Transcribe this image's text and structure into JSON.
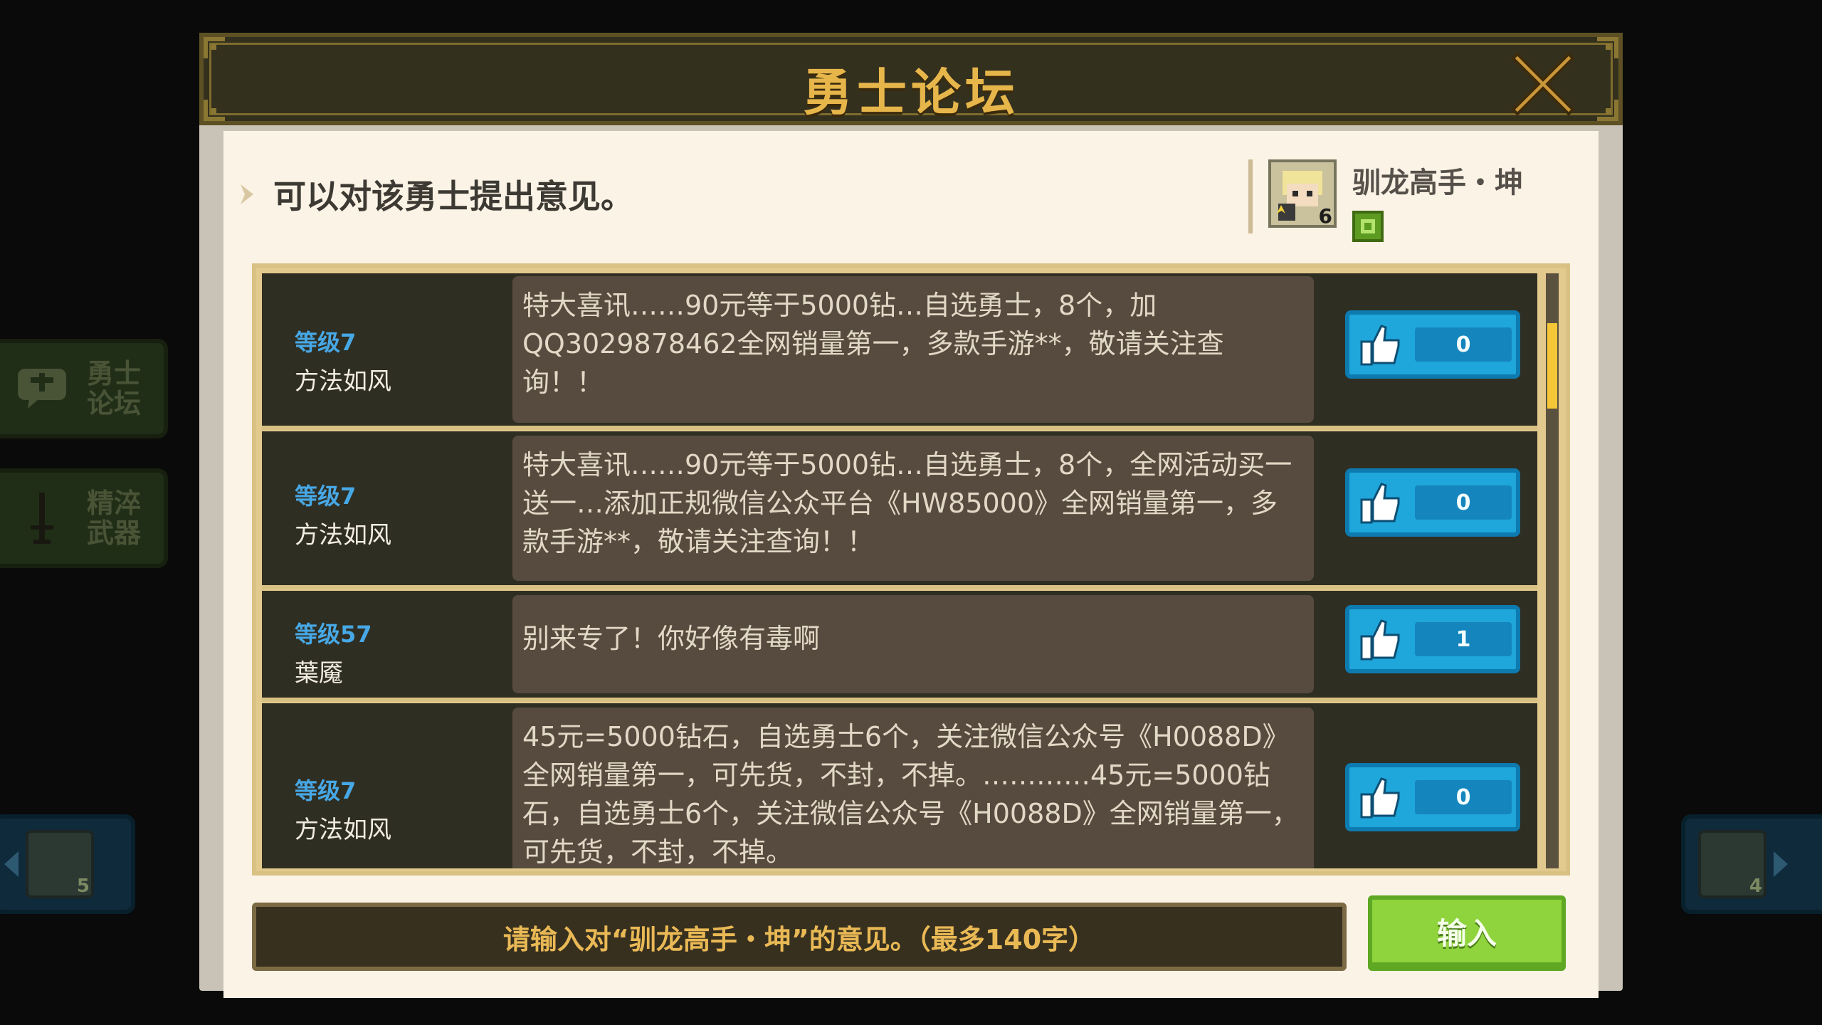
{
  "side_tabs": [
    {
      "label": "勇士\n论坛",
      "icon": "chat-bubble-icon"
    },
    {
      "label": "精淬\n武器",
      "icon": "sword-icon"
    }
  ],
  "nav": {
    "prev_star": "5",
    "next_star": "4"
  },
  "dialog": {
    "title": "勇士论坛",
    "hint": "可以对该勇士提出意见。",
    "hero": {
      "name": "驯龙高手・坤",
      "star": "6"
    }
  },
  "comments": [
    {
      "level": "等级7",
      "author": "方法如风",
      "text": "特大喜讯……90元等于5000钻…自选勇士，8个，加QQ3029878462全网销量第一，多款手游**，敬请关注查询！！",
      "likes": "0"
    },
    {
      "level": "等级7",
      "author": "方法如风",
      "text": "特大喜讯……90元等于5000钻…自选勇士，8个，全网活动买一送一…添加正规微信公众平台《HW85000》全网销量第一，多款手游**，敬请关注查询！！",
      "likes": "0"
    },
    {
      "level": "等级57",
      "author": "葉魇",
      "text": "别来专了！你好像有毒啊",
      "likes": "1"
    },
    {
      "level": "等级7",
      "author": "方法如风",
      "text": "45元=5000钻石，自选勇士6个，关注微信公众号《H0088D》全网销量第一，可先货，不封，不掉。…………45元=5000钻石，自选勇士6个，关注微信公众号《H0088D》全网销量第一，可先货，不封，不掉。",
      "likes": "0"
    }
  ],
  "input": {
    "placeholder": "请输入对“驯龙高手・坤”的意见。（最多140字）",
    "submit_label": "输入"
  },
  "colors": {
    "title_gold": "#e7b64b",
    "level_blue": "#47a8e6",
    "like_blue": "#1fa6da",
    "submit_green": "#8fd33d",
    "scroll_yellow": "#f5c637"
  }
}
